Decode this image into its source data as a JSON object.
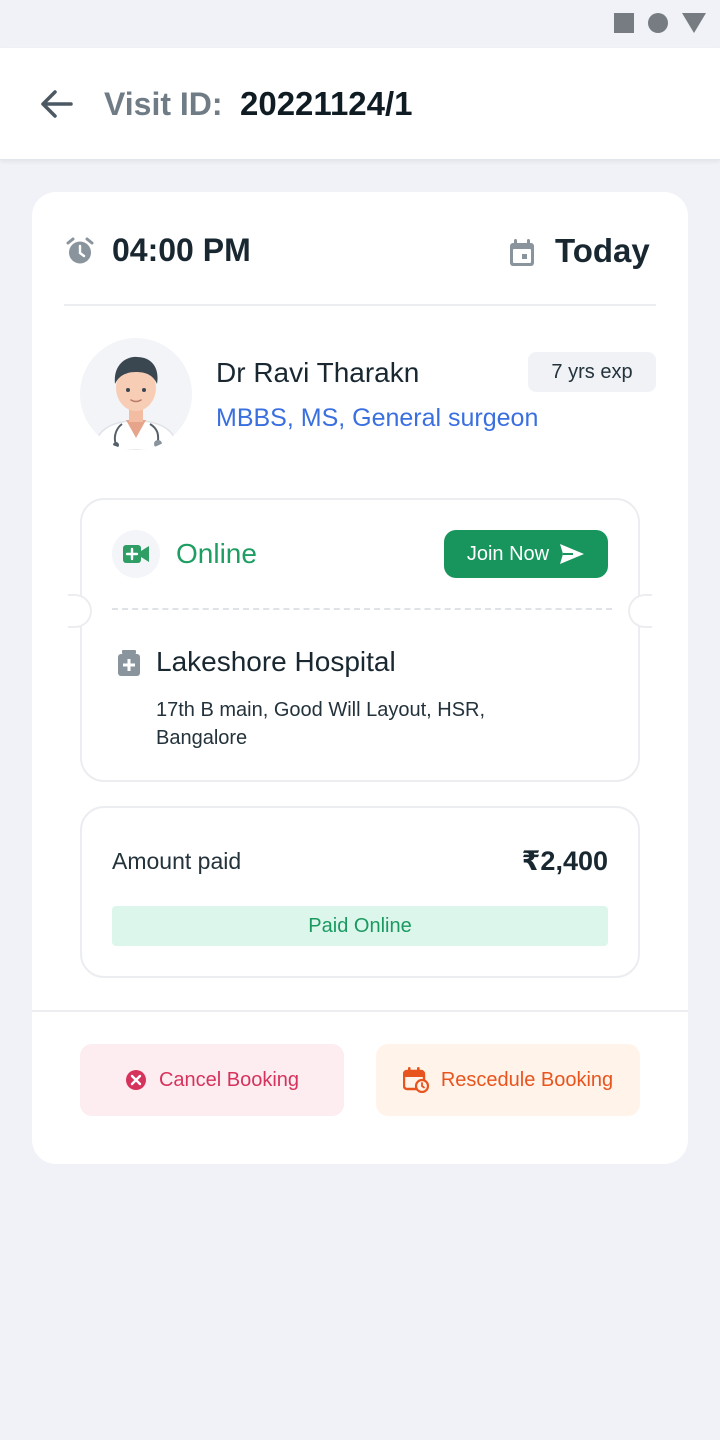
{
  "colors": {
    "background": "#f0f2f8",
    "accent_green": "#17955d",
    "link_blue": "#3a6fe0",
    "cancel_red": "#d6335c",
    "reschedule_orange": "#e8541e"
  },
  "status_bar": {
    "icons": [
      "stop-square-icon",
      "home-circle-icon",
      "back-triangle-icon"
    ]
  },
  "header": {
    "back_icon": "arrow-left-icon",
    "visit_label": "Visit ID:",
    "visit_id": "20221124/1"
  },
  "appointment": {
    "time_icon": "alarm-clock-icon",
    "time": "04:00 PM",
    "date_icon": "calendar-icon",
    "date": "Today"
  },
  "doctor": {
    "avatar_icon": "doctor-avatar-icon",
    "name": "Dr Ravi Tharakn",
    "qualifications": "MBBS, MS, General surgeon",
    "experience": "7 yrs exp"
  },
  "consultation": {
    "mode_icon": "video-call-icon",
    "mode": "Online",
    "join_label": "Join Now",
    "join_icon": "send-icon",
    "hospital_icon": "hospital-icon",
    "hospital_name": "Lakeshore Hospital",
    "hospital_address": "17th B main, Good Will Layout, HSR, Bangalore"
  },
  "payment": {
    "label": "Amount paid",
    "amount": "₹2,400",
    "status": "Paid Online"
  },
  "actions": {
    "cancel_icon": "cancel-circle-icon",
    "cancel_label": "Cancel Booking",
    "reschedule_icon": "calendar-reschedule-icon",
    "reschedule_label": "Rescedule Booking"
  }
}
